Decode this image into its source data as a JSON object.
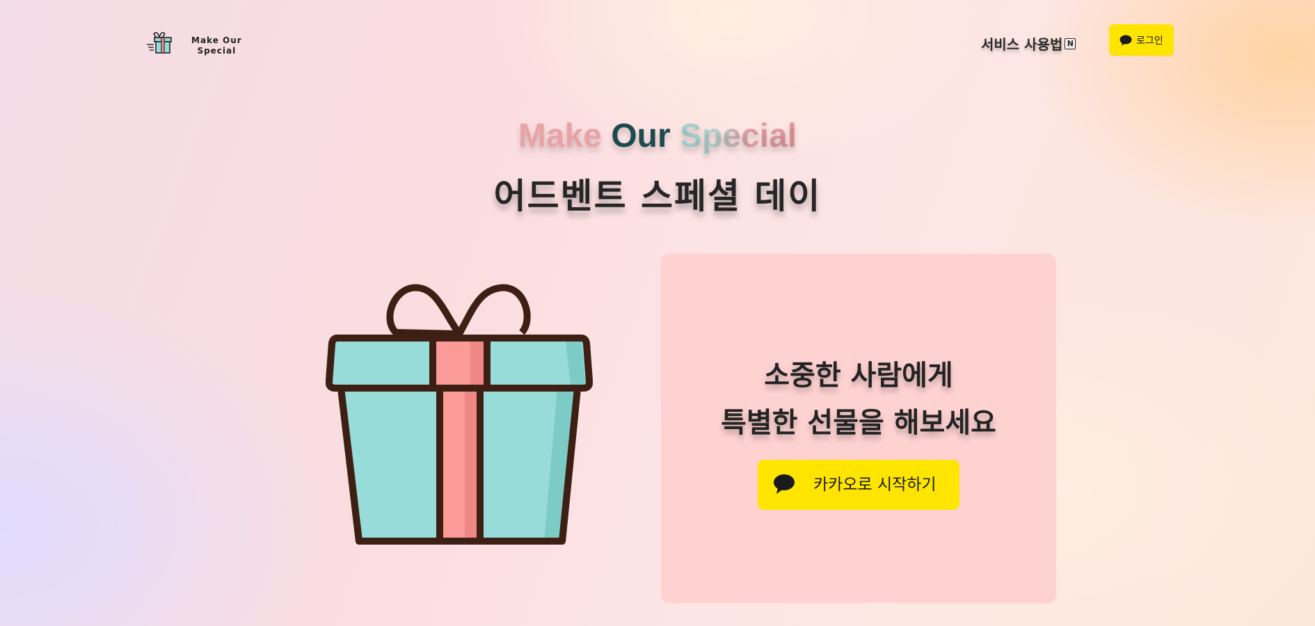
{
  "header": {
    "logo_line1": "Make Our",
    "logo_line2": "Special",
    "nav_guide": "서비스 사용법",
    "notion_glyph": "N",
    "login_label": "로그인"
  },
  "hero": {
    "title_word1": "Make",
    "title_word2": "Our",
    "title_word3": "Special",
    "subtitle": "어드벤트 스페셜 데이"
  },
  "card": {
    "line1": "소중한 사람에게",
    "line2": "특별한 선물을 해보세요",
    "cta_label": "카카오로 시작하기"
  },
  "icons": {
    "logo": "gift-logo-icon",
    "notion": "notion-icon",
    "kakao": "kakao-chat-bubble-icon",
    "hero": "gift-box-illustration"
  },
  "colors": {
    "kakao_yellow": "#fee500",
    "card_bg": "#ffd2d2",
    "gift_teal": "#97dcd8",
    "ribbon_pink": "#fb9b97",
    "outline": "#3e1f14"
  }
}
